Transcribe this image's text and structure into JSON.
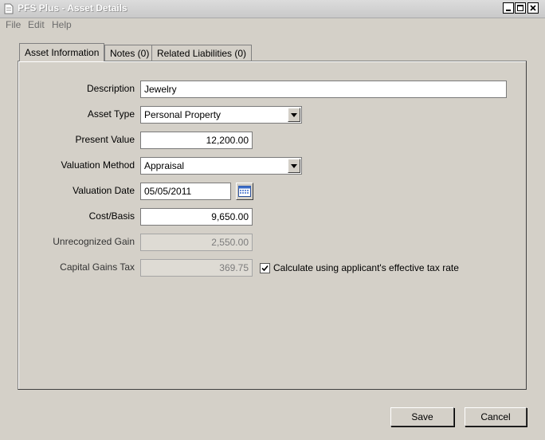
{
  "window": {
    "title": "PFS Plus - Asset Details"
  },
  "menu": {
    "file": "File",
    "edit": "Edit",
    "help": "Help"
  },
  "tabs": [
    {
      "label": "Asset Information",
      "active": true
    },
    {
      "label": "Notes (0)",
      "active": false
    },
    {
      "label": "Related Liabilities (0)",
      "active": false
    }
  ],
  "form": {
    "description": {
      "label": "Description",
      "value": "Jewelry"
    },
    "asset_type": {
      "label": "Asset Type",
      "value": "Personal Property"
    },
    "present_value": {
      "label": "Present Value",
      "value": "12,200.00"
    },
    "valuation_method": {
      "label": "Valuation Method",
      "value": "Appraisal"
    },
    "valuation_date": {
      "label": "Valuation Date",
      "value": "05/05/2011"
    },
    "cost_basis": {
      "label": "Cost/Basis",
      "value": "9,650.00"
    },
    "unrecognized_gain": {
      "label": "Unrecognized Gain",
      "value": "2,550.00"
    },
    "capital_gains_tax": {
      "label": "Capital Gains Tax",
      "value": "369.75"
    },
    "calc_checkbox": {
      "label": "Calculate using applicant's effective tax rate",
      "checked": true
    }
  },
  "buttons": {
    "save": "Save",
    "cancel": "Cancel"
  },
  "colors": {
    "face": "#d4d0c8",
    "field": "#ffffff",
    "disabled_field": "#dedbd4",
    "title_bar": "#c9c9c9"
  },
  "icons": {
    "app": "document-icon",
    "calendar": "calendar-icon",
    "dropdown": "chevron-down-icon"
  }
}
